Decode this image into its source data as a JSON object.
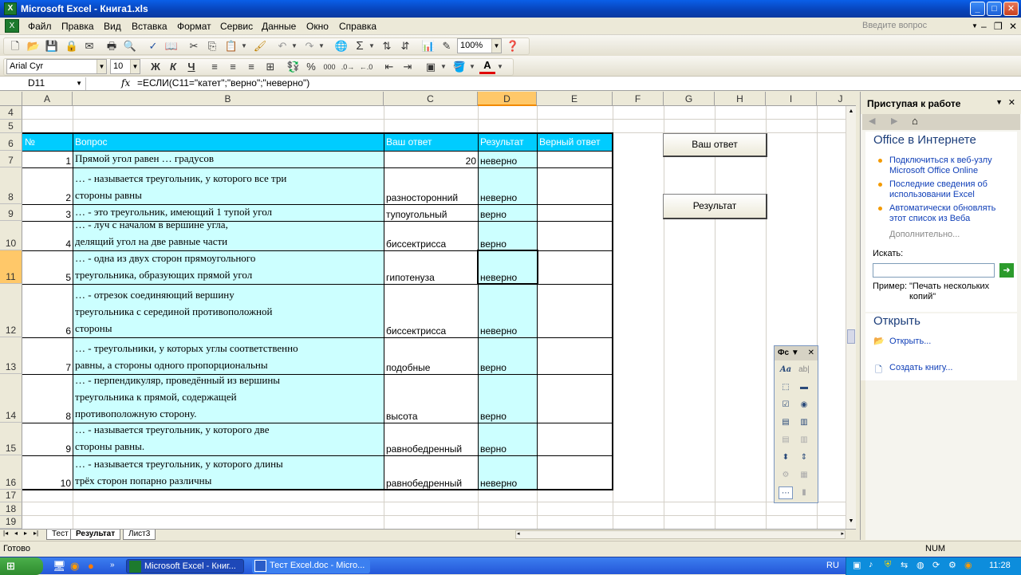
{
  "window": {
    "title": "Microsoft Excel - Книга1.xls",
    "min": "_",
    "max": "□",
    "close": "✕"
  },
  "menu": {
    "items": [
      "Файл",
      "Правка",
      "Вид",
      "Вставка",
      "Формат",
      "Сервис",
      "Данные",
      "Окно",
      "Справка"
    ],
    "help_placeholder": "Введите вопрос"
  },
  "toolbar": {
    "zoom": "100%",
    "font": "Arial Cyr",
    "size": "10",
    "bold": "Ж",
    "italic": "К",
    "underline": "Ч",
    "sigma": "Σ",
    "percent": "%",
    "thousands": "000"
  },
  "formula_bar": {
    "name_box": "D11",
    "fx": "fx",
    "formula": "=ЕСЛИ(C11=\"катет\";\"верно\";\"неверно\")"
  },
  "columns": [
    "A",
    "B",
    "C",
    "D",
    "E",
    "F",
    "G",
    "H",
    "I",
    "J"
  ],
  "selected_column": "D",
  "selected_row": "11",
  "rows": [
    "4",
    "5",
    "6",
    "7",
    "8",
    "9",
    "10",
    "11",
    "12",
    "13",
    "14",
    "15",
    "16",
    "17",
    "18",
    "19"
  ],
  "table": {
    "headers": [
      "№",
      "Вопрос",
      "Ваш ответ",
      "Результат",
      "Верный ответ"
    ],
    "rows": [
      {
        "n": "1",
        "q": [
          "Прямой угол равен … градусов"
        ],
        "answer": "20",
        "result": "неверно",
        "answer_numeric": true
      },
      {
        "n": "2",
        "q": [
          "… - называется треугольник, у которого все три",
          "стороны равны"
        ],
        "answer": "разносторонний",
        "result": "неверно"
      },
      {
        "n": "3",
        "q": [
          "… - это треугольник, имеющий 1 тупой угол"
        ],
        "answer": "тупоугольный",
        "result": "верно"
      },
      {
        "n": "4",
        "q": [
          "… - луч с началом в вершине угла,",
          "делящий угол на две равные части"
        ],
        "answer": "биссектрисса",
        "result": "верно"
      },
      {
        "n": "5",
        "q": [
          "… - одна из двух сторон прямоугольного",
          "треугольника, образующих прямой угол"
        ],
        "answer": "гипотенуза",
        "result": "неверно"
      },
      {
        "n": "6",
        "q": [
          "… - отрезок соединяющий вершину",
          "треугольника с серединой противоположной",
          "стороны"
        ],
        "answer": "биссектрисса",
        "result": "неверно"
      },
      {
        "n": "7",
        "q": [
          "… - треугольники, у которых углы соответственно",
          "равны, а стороны одного пропорциональны"
        ],
        "answer": "подобные",
        "result": "верно"
      },
      {
        "n": "8",
        "q": [
          "… - перпендикуляр, проведённый из вершины",
          "треугольника к прямой, содержащей",
          "противоположную сторону."
        ],
        "answer": "высота",
        "result": "верно"
      },
      {
        "n": "9",
        "q": [
          "… - называется треугольник, у которого две",
          "стороны равны."
        ],
        "answer": "равнобедренный",
        "result": "верно"
      },
      {
        "n": "10",
        "q": [
          "… - называется треугольник, у которого длины",
          "трёх сторон попарно различны"
        ],
        "answer": "равнобедренный",
        "result": "неверно"
      }
    ]
  },
  "buttons": {
    "your_answer": "Ваш ответ",
    "result": "Результат"
  },
  "sheet_tabs": [
    "Тест",
    "Результат",
    "Лист3"
  ],
  "active_tab": "Результат",
  "status": {
    "ready": "Готово",
    "num": "NUM"
  },
  "task_pane": {
    "title": "Приступая к работе",
    "office_online": "Office в Интернете",
    "links": [
      "Подключиться к веб-узлу Microsoft Office Online",
      "Последние сведения об использовании Excel",
      "Автоматически обновлять этот список из Веба"
    ],
    "more": "Дополнительно...",
    "search_label": "Искать:",
    "example_label": "Пример:",
    "example_text": "\"Печать нескольких копий\"",
    "open_header": "Открыть",
    "open_link": "Открыть...",
    "create_link": "Создать книгу..."
  },
  "forms_toolbar": {
    "title": "Фс"
  },
  "taskbar": {
    "items": [
      "Microsoft Excel - Книг...",
      "Тест Excel.doc - Micro..."
    ],
    "lang": "RU",
    "time": "11:28"
  },
  "colors": {
    "header_fill": "#00ccff",
    "cell_fill": "#ccffff",
    "selection": "#ffc869"
  }
}
